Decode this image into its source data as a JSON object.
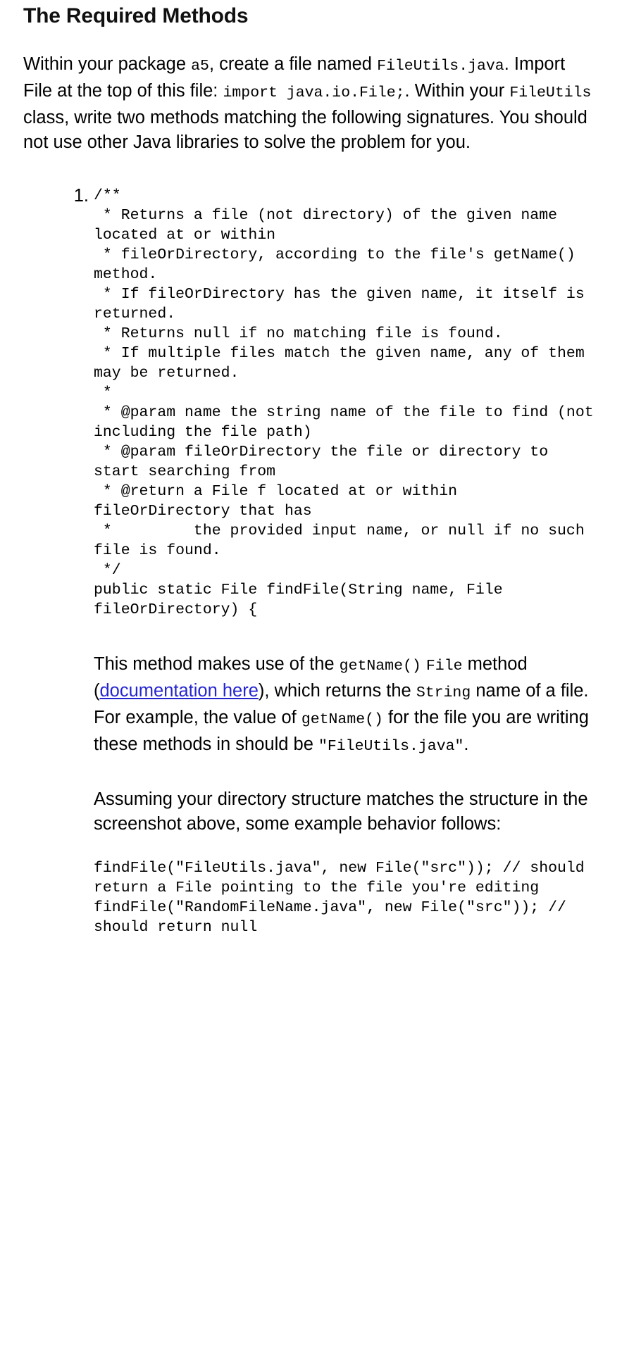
{
  "document": {
    "title": "The Required Methods",
    "intro": {
      "seg1": "Within your package ",
      "code1": "a5",
      "seg2": ", create a file named ",
      "code2": "FileUtils.java",
      "seg3": ". Import File at the top of this file: ",
      "code3": "import java.io.File;",
      "seg4": ". Within your ",
      "code4": "FileUtils",
      "seg5": " class, write two methods matching the following signatures. You should not use other Java libraries to solve the problem for you."
    },
    "list": {
      "item1": {
        "marker": "1.",
        "code": "/**\n * Returns a file (not directory) of the given name located at or within\n * fileOrDirectory, according to the file's getName() method.\n * If fileOrDirectory has the given name, it itself is returned.\n * Returns null if no matching file is found.\n * If multiple files match the given name, any of them may be returned.\n *\n * @param name the string name of the file to find (not including the file path)\n * @param fileOrDirectory the file or directory to start searching from\n * @return a File f located at or within fileOrDirectory that has\n *         the provided input name, or null if no such file is found.\n */\npublic static File findFile(String name, File fileOrDirectory) {",
        "para_a": {
          "seg1": "This method makes use of the ",
          "code1": "getName()",
          "seg2": " ",
          "code2": "File",
          "seg3": " method (",
          "link_text": "documentation here",
          "seg4": "), which returns the ",
          "code3": "String",
          "seg5": " name of a file. For example, the value of ",
          "code4": "getName()",
          "seg6": " for the file you are writing these methods in should be ",
          "code5": "\"FileUtils.java\"",
          "seg7": "."
        },
        "para_b": "Assuming your directory structure matches the structure in the screenshot above, some example behavior follows:",
        "example_code": "findFile(\"FileUtils.java\", new File(\"src\")); // should return a File pointing to the file you're editing\nfindFile(\"RandomFileName.java\", new File(\"src\")); // should return null"
      }
    }
  },
  "colors": {
    "text": "#000000",
    "link": "#2525d0",
    "background": "#ffffff",
    "heading": "#111111"
  }
}
